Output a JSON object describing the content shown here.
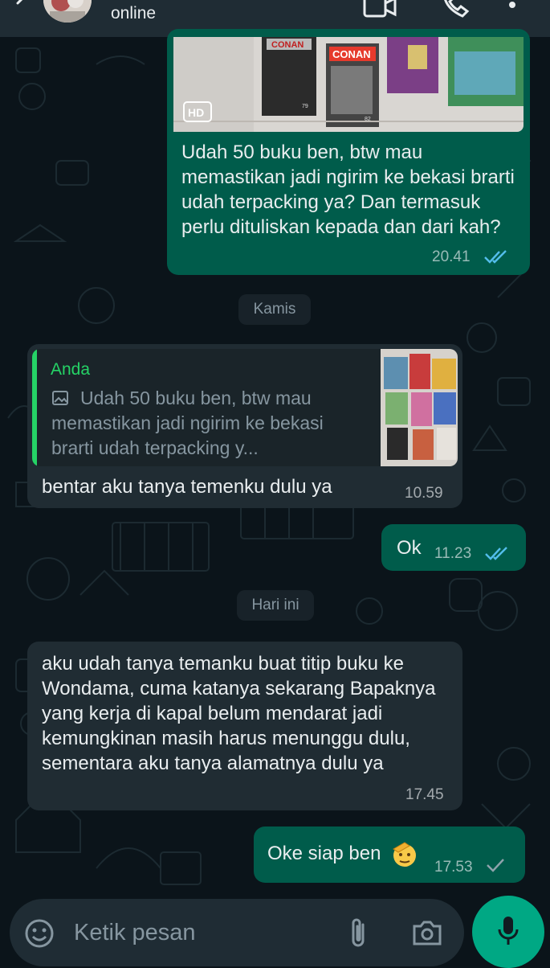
{
  "header": {
    "status": "online",
    "icons": [
      "back-arrow-icon",
      "contact-avatar",
      "video-call-icon",
      "voice-call-icon",
      "menu-icon"
    ]
  },
  "messages": {
    "m1": {
      "image_badge": "HD",
      "cover_text_1": "CONAN",
      "cover_text_2": "CONAN",
      "cover_num_1": "79",
      "cover_num_2": "82",
      "text": "Udah 50 buku ben, btw mau memastikan jadi ngirim ke bekasi brarti udah terpacking ya? Dan termasuk perlu dituliskan kepada dan dari kah?",
      "time": "20.41",
      "status": "read"
    },
    "date1": "Kamis",
    "m2": {
      "quote_author": "Anda",
      "quote_text": "Udah 50 buku ben, btw mau memastikan jadi ngirim ke bekasi brarti udah terpacking y...",
      "text": "bentar aku tanya temenku dulu ya",
      "time": "10.59"
    },
    "m3": {
      "text": "Ok",
      "time": "11.23",
      "status": "read"
    },
    "date2": "Hari ini",
    "m4": {
      "text": "aku udah tanya temanku buat titip buku ke Wondama, cuma katanya sekarang Bapaknya yang kerja di kapal belum mendarat jadi kemungkinan masih harus menunggu dulu, sementara aku tanya alamatnya dulu ya",
      "time": "17.45"
    },
    "m5": {
      "text": "Oke siap ben",
      "emoji": "saluting-face",
      "time": "17.53",
      "status": "sent"
    }
  },
  "composer": {
    "placeholder": "Ketik pesan"
  },
  "colors": {
    "background": "#0b141a",
    "outgoing": "#005c4b",
    "incoming": "#202c33",
    "accent": "#00a884",
    "read_ticks": "#53bdeb",
    "quote_author": "#25d366"
  }
}
